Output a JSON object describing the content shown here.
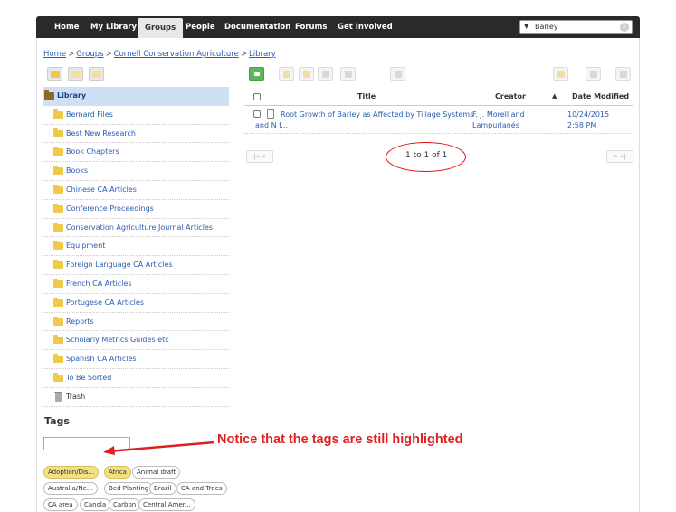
{
  "nav": {
    "items": [
      "Home",
      "My Library",
      "Groups",
      "People",
      "Documentation",
      "Forums",
      "Get Involved"
    ],
    "active": "Groups",
    "search_value": "Barley"
  },
  "breadcrumb": [
    "Home",
    "Groups",
    "Cornell Conservation Agriculture",
    "Library"
  ],
  "collections": [
    "Library",
    "Bernard Files",
    "Best New Research",
    "Book Chapters",
    "Books",
    "Chinese CA Articles",
    "Conference Proceedings",
    "Conservation Agriculture Journal Articles",
    "Equipment",
    "Foreign Language CA Articles",
    "French CA Articles",
    "Portugese CA Articles",
    "Reports",
    "Scholarly Metrics Guides etc",
    "Spanish CA Articles",
    "To Be Sorted",
    "Trash"
  ],
  "tags": {
    "heading": "Tags",
    "items": [
      {
        "label": "Adoption/Dis...",
        "highlighted": true
      },
      {
        "label": "Africa",
        "highlighted": true
      },
      {
        "label": "Animal draft",
        "highlighted": false
      },
      {
        "label": "Australia/Ne...",
        "highlighted": false
      },
      {
        "label": "Bed Planting",
        "highlighted": false
      },
      {
        "label": "Brazil",
        "highlighted": false
      },
      {
        "label": "CA and Trees",
        "highlighted": false
      },
      {
        "label": "CA area",
        "highlighted": false
      },
      {
        "label": "Canola",
        "highlighted": false
      },
      {
        "label": "Carbon",
        "highlighted": false
      },
      {
        "label": "Central Amer...",
        "highlighted": false
      }
    ]
  },
  "table": {
    "columns": {
      "title": "Title",
      "creator": "Creator",
      "date": "Date Modified"
    },
    "rows": [
      {
        "title_line1": "Root Growth of Barley as Affected by Tillage Systems",
        "title_line2": "and N f...",
        "creator_line1": "F. J. Morell and",
        "creator_line2": "Lampurlanés",
        "date_line1": "10/24/2015",
        "date_line2": "2:58 PM"
      }
    ]
  },
  "pagination": {
    "text": "1 to 1 of 1",
    "first": "|«",
    "prev": "«",
    "next": "»",
    "last": "»|"
  },
  "annotation": "Notice that the tags are still highlighted",
  "colors": {
    "link": "#2a5db0",
    "selected": "#cfe0f5",
    "tag_highlight": "#f3df85",
    "annotation": "#e02020"
  }
}
